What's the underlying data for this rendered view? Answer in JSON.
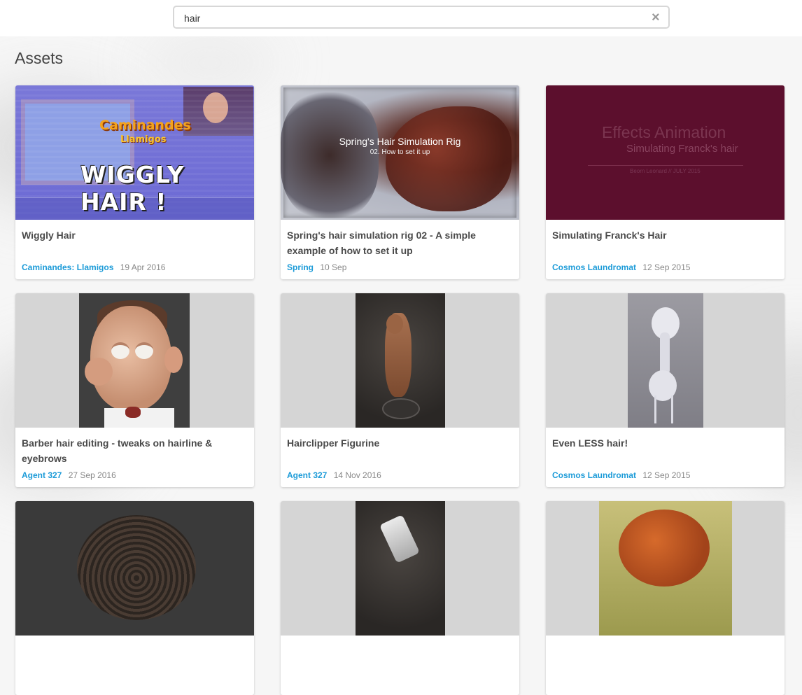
{
  "search": {
    "value": "hair",
    "placeholder": "",
    "clear_icon": "close-icon"
  },
  "section": {
    "title": "Assets"
  },
  "cards": [
    {
      "title": "Wiggly Hair",
      "project": "Caminandes: Llamigos",
      "date": "19 Apr 2016",
      "thumb_text": {
        "logo_line1": "Caminandes",
        "logo_line2": "Llamigos",
        "big": "WIGGLY HAIR !"
      }
    },
    {
      "title": "Spring's hair simulation rig 02 - A simple example of how to set it up",
      "project": "Spring",
      "date": "10 Sep",
      "thumb_text": {
        "line1": "Spring's Hair Simulation Rig",
        "line2": "02. How to set it up"
      }
    },
    {
      "title": "Simulating Franck's Hair",
      "project": "Cosmos Laundromat",
      "date": "12 Sep 2015",
      "thumb_text": {
        "line1": "Effects Animation",
        "line2": "Simulating Franck's hair",
        "line3": "Beorn Leonard // JULY 2015"
      }
    },
    {
      "title": "Barber hair editing - tweaks on hairline & eyebrows",
      "project": "Agent 327",
      "date": "27 Sep 2016"
    },
    {
      "title": "Hairclipper Figurine",
      "project": "Agent 327",
      "date": "14 Nov 2016"
    },
    {
      "title": "Even LESS hair!",
      "project": "Cosmos Laundromat",
      "date": "12 Sep 2015"
    }
  ],
  "colors": {
    "accent_link": "#1c9bd8",
    "title_text": "#4a4a4a",
    "date_text": "#888888",
    "background": "#f6f6f6"
  }
}
